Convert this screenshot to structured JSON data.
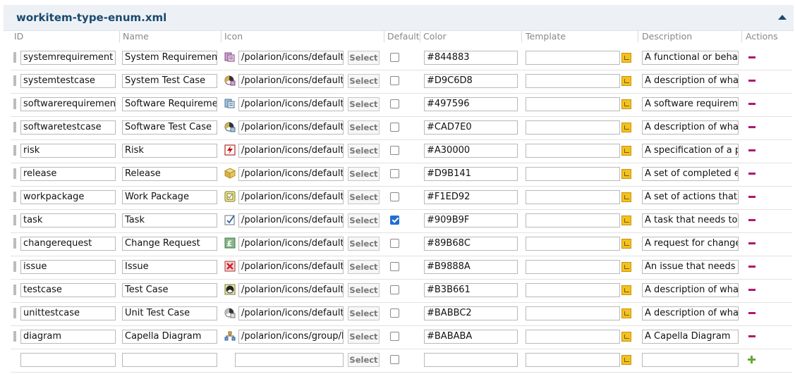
{
  "panel": {
    "title": "workitem-type-enum.xml"
  },
  "columns": {
    "id": "ID",
    "name": "Name",
    "icon": "Icon",
    "default": "Default",
    "color": "Color",
    "template": "Template",
    "description": "Description",
    "actions": "Actions"
  },
  "select_label": "Select",
  "rows": [
    {
      "id": "systemrequirement",
      "name": "System Requirement",
      "icon_path": "/polarion/icons/default/enums/type_system_requirement.png",
      "icon": "system-requirement-icon",
      "default": false,
      "color": "#844883",
      "template": "",
      "description": "A functional or behavioral requirement"
    },
    {
      "id": "systemtestcase",
      "name": "System Test Case",
      "icon_path": "/polarion/icons/default/enums/type_system_testcase.png",
      "icon": "system-test-case-icon",
      "default": false,
      "color": "#D9C6D8",
      "template": "",
      "description": "A description of what needs to be tested"
    },
    {
      "id": "softwarerequirement",
      "name": "Software Requirement",
      "icon_path": "/polarion/icons/default/enums/type_software_requirement.png",
      "icon": "software-requirement-icon",
      "default": false,
      "color": "#497596",
      "template": "",
      "description": "A software requirement"
    },
    {
      "id": "softwaretestcase",
      "name": "Software Test Case",
      "icon_path": "/polarion/icons/default/enums/type_software_testcase.png",
      "icon": "software-test-case-icon",
      "default": false,
      "color": "#CAD7E0",
      "template": "",
      "description": "A description of what needs to be tested"
    },
    {
      "id": "risk",
      "name": "Risk",
      "icon_path": "/polarion/icons/default/enums/type_risk.png",
      "icon": "risk-icon",
      "default": false,
      "color": "#A30000",
      "template": "",
      "description": "A specification of a possible risk"
    },
    {
      "id": "release",
      "name": "Release",
      "icon_path": "/polarion/icons/default/enums/type_release.png",
      "icon": "release-icon",
      "default": false,
      "color": "#D9B141",
      "template": "",
      "description": "A set of completed efforts"
    },
    {
      "id": "workpackage",
      "name": "Work Package",
      "icon_path": "/polarion/icons/default/enums/type_workpackage.png",
      "icon": "work-package-icon",
      "default": false,
      "color": "#F1ED92",
      "template": "",
      "description": "A set of actions that need to be done"
    },
    {
      "id": "task",
      "name": "Task",
      "icon_path": "/polarion/icons/default/enums/type_task.png",
      "icon": "task-icon",
      "default": true,
      "color": "#909B9F",
      "template": "",
      "description": "A task that needs to be done"
    },
    {
      "id": "changerequest",
      "name": "Change Request",
      "icon_path": "/polarion/icons/default/enums/type_change_request.png",
      "icon": "change-request-icon",
      "default": false,
      "color": "#89B68C",
      "template": "",
      "description": "A request for change of requirements"
    },
    {
      "id": "issue",
      "name": "Issue",
      "icon_path": "/polarion/icons/default/enums/type_issue.png",
      "icon": "issue-icon",
      "default": false,
      "color": "#B9888A",
      "template": "",
      "description": "An issue that needs to be resolved"
    },
    {
      "id": "testcase",
      "name": "Test Case",
      "icon_path": "/polarion/icons/default/enums/type_testcase.png",
      "icon": "test-case-icon",
      "default": false,
      "color": "#B3B661",
      "template": "",
      "description": "A description of what needs to be tested"
    },
    {
      "id": "unittestcase",
      "name": "Unit Test Case",
      "icon_path": "/polarion/icons/default/enums/type_unit_testcase.png",
      "icon": "unit-test-case-icon",
      "default": false,
      "color": "#BABBC2",
      "template": "",
      "description": "A description of what needs to be tested"
    },
    {
      "id": "diagram",
      "name": "Capella Diagram",
      "icon_path": "/polarion/icons/group/Diagram.png",
      "icon": "diagram-icon",
      "default": false,
      "color": "#BABABA",
      "template": "",
      "description": "A Capella Diagram"
    }
  ],
  "new_row": {
    "id": "",
    "name": "",
    "icon_path": "",
    "color": "",
    "template": "",
    "description": ""
  }
}
